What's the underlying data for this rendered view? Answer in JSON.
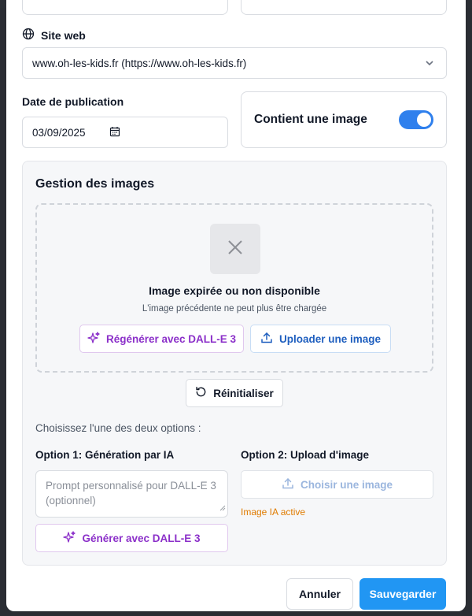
{
  "form": {
    "site_label": "Site web",
    "site_value": "www.oh-les-kids.fr (https://www.oh-les-kids.fr)",
    "date_label": "Date de publication",
    "date_value": "03/09/2025",
    "contains_image_label": "Contient une image",
    "contains_image_on": true
  },
  "images": {
    "title": "Gestion des images",
    "expired_title": "Image expirée ou non disponible",
    "expired_sub": "L'image précédente ne peut plus être chargée",
    "regen_label": "Régénérer avec DALL-E 3",
    "upload_label": "Uploader une image",
    "reset_label": "Réinitialiser",
    "choose_hint": "Choisissez l'une des deux options :",
    "option1_label": "Option 1: Génération par IA",
    "option2_label": "Option 2: Upload d'image",
    "prompt_placeholder": "Prompt personnalisé pour DALL-E 3 (optionnel)",
    "generate_label": "Générer avec DALL-E 3",
    "choose_image_label": "Choisir une image",
    "ia_active_label": "Image IA active"
  },
  "footer": {
    "cancel_label": "Annuler",
    "save_label": "Sauvegarder"
  },
  "colors": {
    "primary": "#2196f3",
    "ai_purple": "#8b2fc9",
    "warning": "#e07b00"
  }
}
